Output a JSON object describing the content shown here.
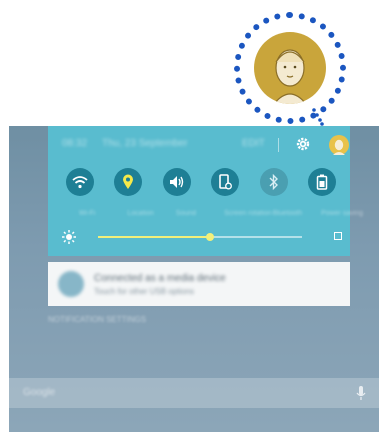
{
  "status_bar": {
    "time": "08:32",
    "date": "Thu, 23 September",
    "edit_label": "EDIT"
  },
  "quick_toggles": [
    {
      "name": "wifi",
      "label": "Wi-Fi",
      "icon": "wifi-icon",
      "on": true
    },
    {
      "name": "location",
      "label": "Location",
      "icon": "location-icon",
      "on": true
    },
    {
      "name": "sound",
      "label": "Sound",
      "icon": "sound-icon",
      "on": true
    },
    {
      "name": "screen-rotation",
      "label": "Screen rotation",
      "icon": "screen-rotation-icon",
      "on": true
    },
    {
      "name": "bluetooth",
      "label": "Bluetooth",
      "icon": "bluetooth-icon",
      "on": false
    },
    {
      "name": "power-saving",
      "label": "Power saving",
      "icon": "battery-icon",
      "on": true
    }
  ],
  "brightness": {
    "level": 0.55,
    "icon": "brightness-icon"
  },
  "notification": {
    "title": "Connected as a media device",
    "subtitle": "Touch for other USB options"
  },
  "notification_footer": "NOTIFICATION SETTINGS",
  "search": {
    "placeholder": "Google"
  },
  "colors": {
    "panel": "#59bccf",
    "toggle_on": "#1e7f95",
    "callout_border": "#1b56c0",
    "avatar": "#c9a53b",
    "slider": "#f2f07a"
  }
}
